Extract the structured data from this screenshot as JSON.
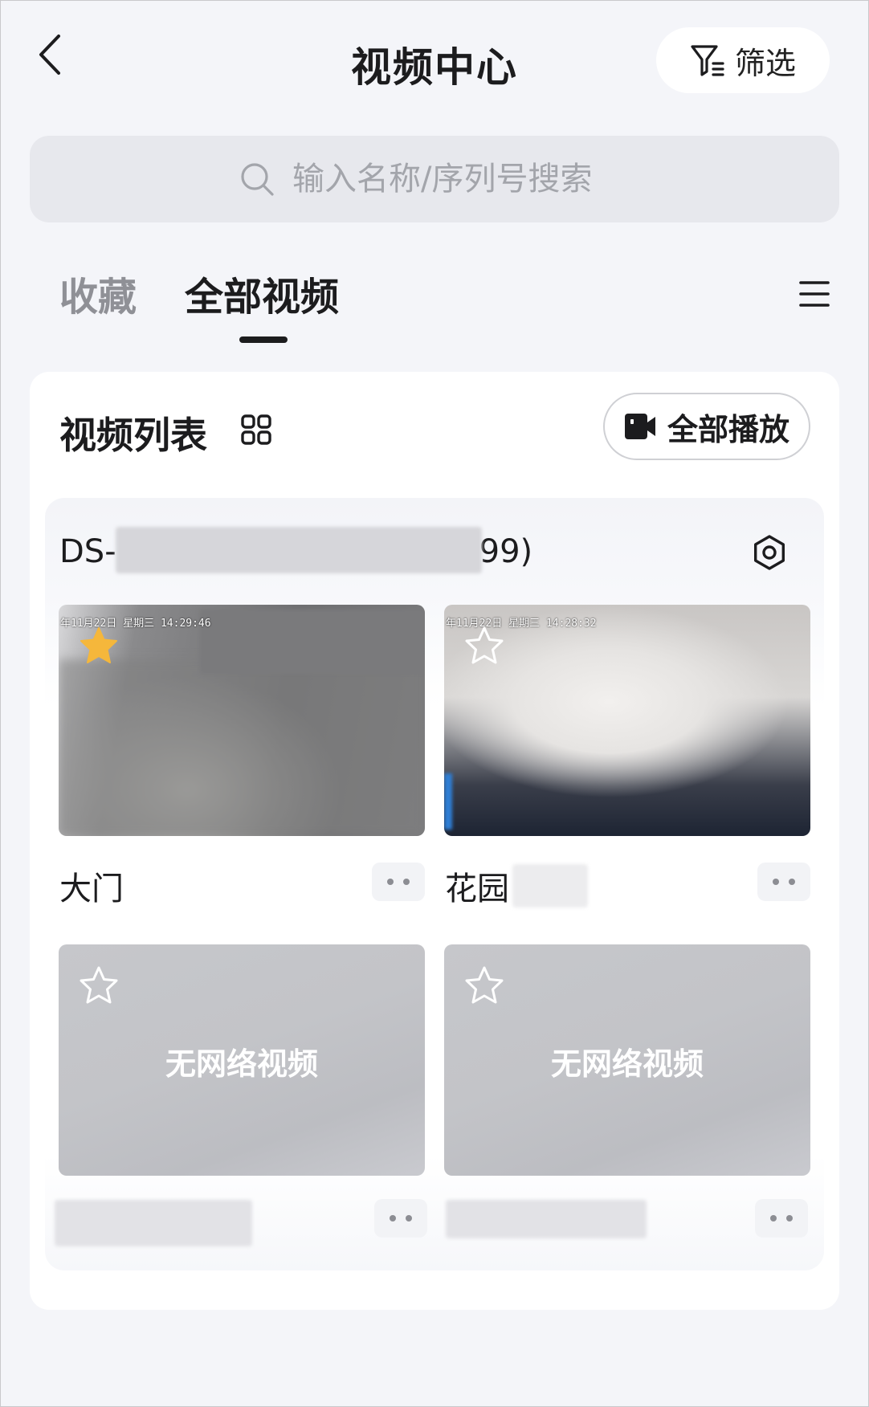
{
  "header": {
    "title": "视频中心",
    "filter_label": "筛选",
    "icons": {
      "back": "chevron-left-icon",
      "filter": "funnel-icon"
    }
  },
  "search": {
    "placeholder": "输入名称/序列号搜索",
    "value": "",
    "icon": "search-icon"
  },
  "tabs": [
    {
      "label": "收藏",
      "active": false
    },
    {
      "label": "全部视频",
      "active": true
    }
  ],
  "list": {
    "title": "视频列表",
    "play_all_label": "全部播放",
    "icons": {
      "layout": "grid-view-icon",
      "menu": "hamburger-menu-icon",
      "play_all": "video-camera-icon"
    }
  },
  "device": {
    "name_prefix": "DS-",
    "name_suffix": "99)",
    "settings_icon": "settings-hex-icon"
  },
  "cameras": [
    {
      "name": "大门",
      "osd": "年11月22日 星期三 14:29:46",
      "favorite": true,
      "status": "live"
    },
    {
      "name": "花园",
      "osd": "年11月22日 星期三 14:28:32",
      "favorite": false,
      "status": "live"
    },
    {
      "name": "",
      "overlay": "无网络视频",
      "favorite": false,
      "status": "offline"
    },
    {
      "name": "",
      "overlay": "无网络视频",
      "favorite": false,
      "status": "offline"
    }
  ],
  "colors": {
    "background": "#f4f5f9",
    "favorite_star": "#f5b73b",
    "text_primary": "#1c1c1e",
    "text_muted": "#8f9096"
  }
}
